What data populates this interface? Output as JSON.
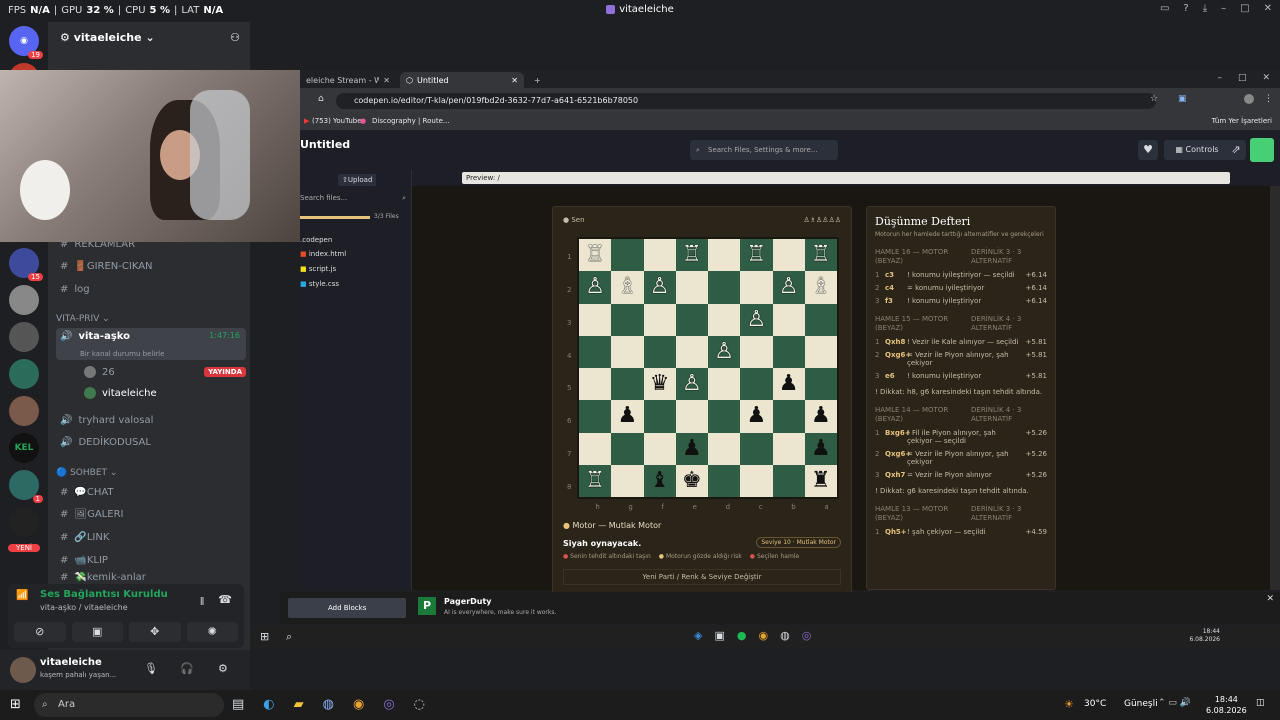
{
  "overlay": {
    "fps_label": "FPS",
    "fps": "N/A",
    "gpu_label": "GPU",
    "gpu": "32 %",
    "cpu_label": "CPU",
    "cpu": "5 %",
    "lat_label": "LAT",
    "lat": "N/A",
    "window_title": "vitaeleiche"
  },
  "server": {
    "name": "vitaeleiche"
  },
  "rail_badges": [
    "19",
    "15",
    "1"
  ],
  "rail_labels": [
    "KD",
    "KEL",
    "YENİ"
  ],
  "channels": {
    "items": [
      {
        "name": "REKLAMLAR"
      },
      {
        "name": "🚪GIREN-CIKAN"
      },
      {
        "name": "log"
      }
    ],
    "cat_priv": "vita-priv",
    "voice_active": {
      "name": "vita-aşko",
      "time": "1:47:16",
      "status": "Bir kanal durumu belirle"
    },
    "members": [
      {
        "name": "26",
        "badge": "YAYINDA"
      },
      {
        "name": "vitaeleiche"
      }
    ],
    "voice_others": [
      "tryhard valosal",
      "DEDİKODUSAL"
    ],
    "cat_sohbet": "SOHBET",
    "text": [
      "💬CHAT",
      "🖼GALERI",
      "🔗LINK",
      "📹KLIP",
      "💸kemik-anlar"
    ]
  },
  "voice_panel": {
    "title": "Ses Bağlantısı Kuruldu",
    "sub": "vita-aşko / vitaeleiche"
  },
  "user_panel": {
    "name": "vitaeleiche",
    "status": "kaşem pahalı yaşan..."
  },
  "browser": {
    "tabs": [
      {
        "title": "eleiche Stream - Watch Live"
      },
      {
        "title": "Untitled"
      }
    ],
    "url": "codepen.io/editor/T-kla/pen/019fbd2d-3632-77d7-a641-6521b6b78050",
    "bookmarks": [
      "(753) YouTube",
      "Discography | Route..."
    ],
    "all_bookmarks": "Tüm Yer İşaretleri"
  },
  "codepen": {
    "title": "Untitled",
    "search": "Search Files, Settings & more...",
    "controls": "Controls",
    "upload": "Upload",
    "search_files": "Search files...",
    "files_count": "3/3 Files",
    "folder": ".codepen",
    "files": [
      "index.html",
      "script.js",
      "style.css"
    ],
    "preview": "Preview: /"
  },
  "game": {
    "you": "Sen",
    "engine": "Motor — Mutlak Motor",
    "black_play": "Siyah oynayacak.",
    "level": "Seviye 10 · Mutlak Motor",
    "legend": [
      "Senin tehdit altındaki taşın",
      "Motorun gözde aldığı risk",
      "Seçilen hamle"
    ],
    "new_game": "Yeni Parti / Renk & Seviye Değiştir",
    "ranks": [
      "1",
      "2",
      "3",
      "4",
      "5",
      "6",
      "7",
      "8"
    ],
    "files": [
      "h",
      "g",
      "f",
      "e",
      "d",
      "c",
      "b",
      "a"
    ]
  },
  "board": [
    [
      "wR",
      "",
      "",
      "wR",
      "",
      "wR",
      "",
      "wR"
    ],
    [
      "wP",
      "wB",
      "wP",
      "",
      "",
      "",
      "wP",
      "wB"
    ],
    [
      "",
      "",
      "",
      "",
      "",
      "wP",
      "",
      ""
    ],
    [
      "",
      "",
      "",
      "",
      "wP",
      "",
      "",
      ""
    ],
    [
      "",
      "",
      "bQ",
      "wP",
      "",
      "",
      "bP",
      ""
    ],
    [
      "",
      "bP",
      "",
      "",
      "",
      "bP",
      "",
      "bP"
    ],
    [
      "",
      "",
      "",
      "bP",
      "",
      "",
      "",
      "bP"
    ],
    [
      "wR",
      "",
      "bB",
      "bK",
      "",
      "",
      "",
      "bR"
    ]
  ],
  "notebook": {
    "title": "Düşünme Defteri",
    "subtitle": "Motorun her hamlede tarttığı alternatifler ve gerekçeleri",
    "blocks": [
      {
        "head": "HAMLE 16 — MOTOR (BEYAZ)",
        "depth": "DERİNLİK 3 · 3 ALTERNATİF",
        "rows": [
          [
            "1",
            "c3",
            "! konumu iyileştiriyor — seçildi",
            "+6.14"
          ],
          [
            "2",
            "c4",
            "= konumu iyileştiriyor",
            "+6.14"
          ],
          [
            "3",
            "f3",
            "! konumu iyileştiriyor",
            "+6.14"
          ]
        ],
        "warn": ""
      },
      {
        "head": "HAMLE 15 — MOTOR (BEYAZ)",
        "depth": "DERİNLİK 4 · 3 ALTERNATİF",
        "rows": [
          [
            "1",
            "Qxh8",
            "! Vezir ile Kale alınıyor — seçildi",
            "+5.81"
          ],
          [
            "2",
            "Qxg6+",
            "= Vezir ile Piyon alınıyor, şah çekiyor",
            "+5.81"
          ],
          [
            "3",
            "e6",
            "! konumu iyileştiriyor",
            "+5.81"
          ]
        ],
        "warn": "! Dikkat: h8, g6 karesindeki taşın tehdit altında."
      },
      {
        "head": "HAMLE 14 — MOTOR (BEYAZ)",
        "depth": "DERİNLİK 4 · 3 ALTERNATİF",
        "rows": [
          [
            "1",
            "Bxg6+",
            "! Fil ile Piyon alınıyor, şah çekiyor — seçildi",
            "+5.26"
          ],
          [
            "2",
            "Qxg6+",
            "= Vezir ile Piyon alınıyor, şah çekiyor",
            "+5.26"
          ],
          [
            "3",
            "Qxh7",
            "= Vezir ile Piyon alınıyor",
            "+5.26"
          ]
        ],
        "warn": "! Dikkat: g6 karesindeki taşın tehdit altında."
      },
      {
        "head": "HAMLE 13 — MOTOR (BEYAZ)",
        "depth": "DERİNLİK 3 · 3 ALTERNATİF",
        "rows": [
          [
            "1",
            "Qh5+",
            "! şah çekiyor — seçildi",
            "+4.59"
          ]
        ],
        "warn": ""
      }
    ]
  },
  "notification": {
    "title": "PagerDuty",
    "body": "AI is everywhere, make sure it works.",
    "add_blocks": "Add Blocks"
  },
  "taskbar": {
    "search": "Ara",
    "weather": "30°C",
    "weather_desc": "Güneşli",
    "time": "18:44",
    "date": "6.08.2026"
  },
  "colors": {
    "board_dark": "#2e5d43",
    "board_light": "#ece6d0",
    "accent": "#e7c27a",
    "live": "#da373c"
  }
}
